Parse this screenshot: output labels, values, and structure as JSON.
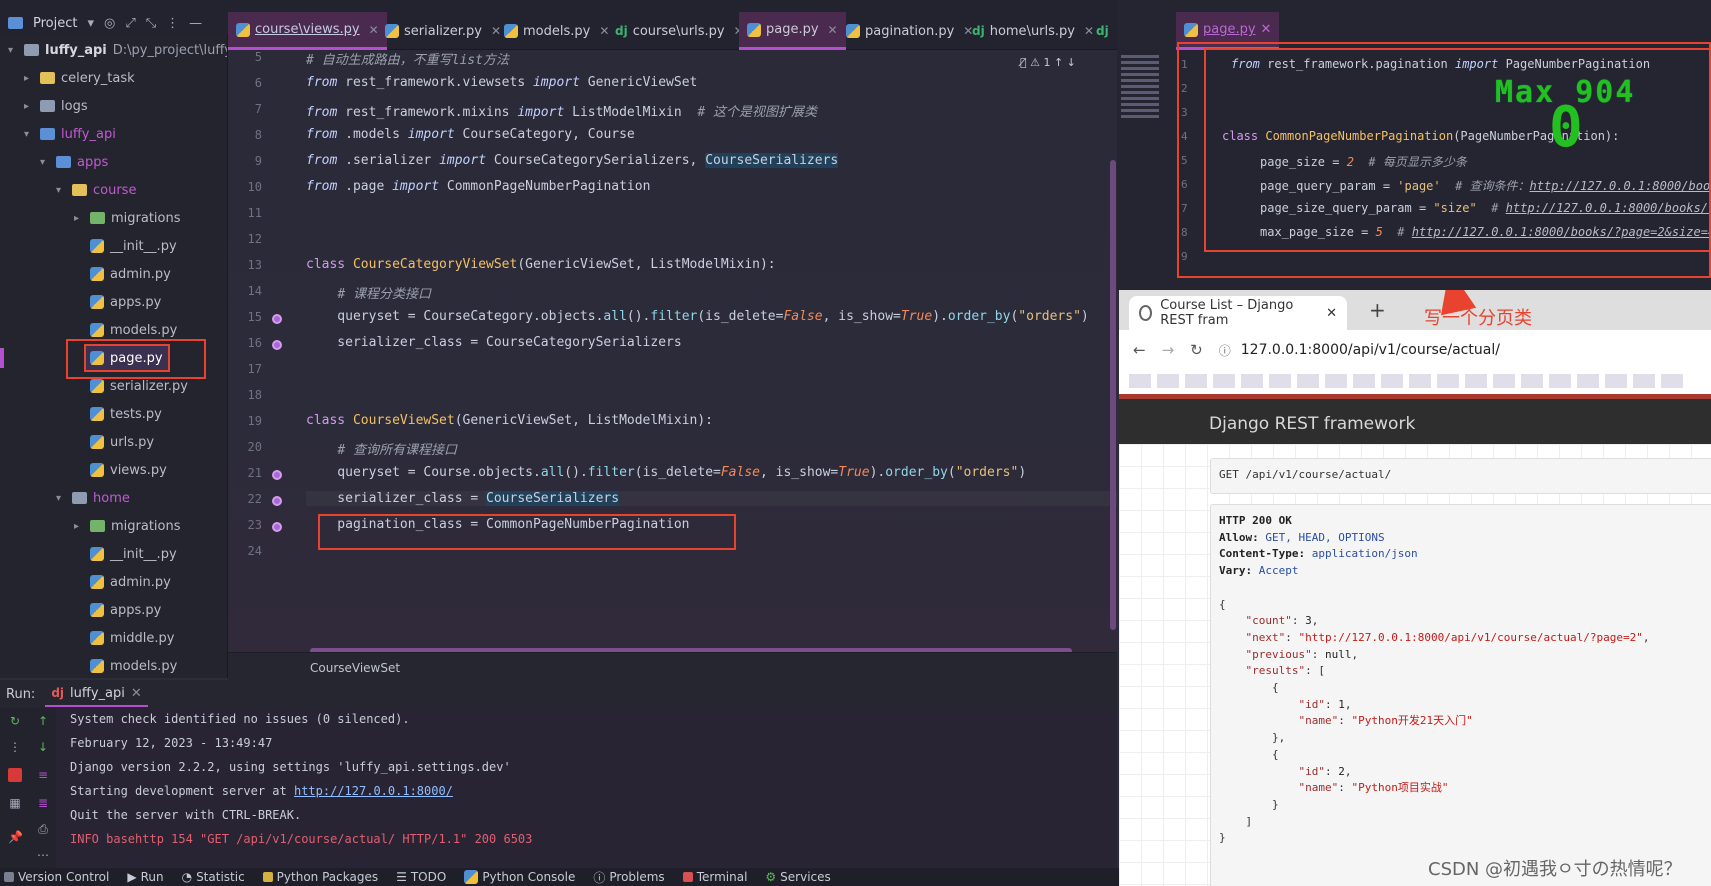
{
  "project_header": {
    "label": "Project"
  },
  "editor_tabs": [
    {
      "name": "course\\views.py",
      "type": "py"
    },
    {
      "name": "serializer.py",
      "type": "py"
    },
    {
      "name": "models.py",
      "type": "py"
    },
    {
      "name": "course\\urls.py",
      "type": "dj"
    },
    {
      "name": "page.py",
      "type": "py"
    },
    {
      "name": "pagination.py",
      "type": "py"
    },
    {
      "name": "home\\urls.py",
      "type": "dj"
    }
  ],
  "tree": {
    "root": {
      "name": "luffy_api",
      "path": "D:\\py_project\\luffy_api"
    },
    "items": [
      {
        "label": "celery_task"
      },
      {
        "label": "logs"
      },
      {
        "label": "luffy_api"
      },
      {
        "label": "apps"
      },
      {
        "label": "course"
      },
      {
        "label": "migrations"
      },
      {
        "label": "__init__.py"
      },
      {
        "label": "admin.py"
      },
      {
        "label": "apps.py"
      },
      {
        "label": "models.py"
      },
      {
        "label": "page.py"
      },
      {
        "label": "serializer.py"
      },
      {
        "label": "tests.py"
      },
      {
        "label": "urls.py"
      },
      {
        "label": "views.py"
      },
      {
        "label": "home"
      },
      {
        "label": "migrations"
      },
      {
        "label": "__init__.py"
      },
      {
        "label": "admin.py"
      },
      {
        "label": "apps.py"
      },
      {
        "label": "middle.py"
      },
      {
        "label": "models.py"
      }
    ]
  },
  "editor": {
    "line_numbers": [
      "5",
      "6",
      "7",
      "8",
      "9",
      "10",
      "11",
      "12",
      "13",
      "14",
      "15",
      "16",
      "17",
      "18",
      "19",
      "20",
      "21",
      "22",
      "23",
      "24"
    ],
    "inspection_count": "1",
    "breadcrumb": "CourseViewSet"
  },
  "right_pane": {
    "tab_name": "page.py",
    "line_numbers": [
      "1",
      "2",
      "3",
      "4",
      "5",
      "6",
      "7",
      "8",
      "9"
    ],
    "overlay_text": "Max 904",
    "overlay_digit": "0"
  },
  "browser": {
    "tab_title": "Course List – Django REST fram",
    "annotation": "写一个分页类",
    "url": "127.0.0.1:8000/api/v1/course/actual/",
    "brand": "Django REST framework",
    "request": "GET /api/v1/course/actual/",
    "watermark": "CSDN @初遇我ㅇ寸の热情呢？"
  },
  "run": {
    "label": "Run:",
    "tab": "luffy_api",
    "lines": [
      "System check identified no issues (0 silenced).",
      "February 12, 2023 - 13:49:47",
      "Django version 2.2.2, using settings 'luffy_api.settings.dev'",
      "Starting development server at ",
      "http://127.0.0.1:8000/",
      "Quit the server with CTRL-BREAK.",
      "INFO basehttp 154 \"GET /api/v1/course/actual/ HTTP/1.1\" 200 6503"
    ]
  },
  "status_bar": [
    {
      "label": "Version Control"
    },
    {
      "label": "Run"
    },
    {
      "label": "Statistic"
    },
    {
      "label": "Python Packages"
    },
    {
      "label": "TODO"
    },
    {
      "label": "Python Console"
    },
    {
      "label": "Problems"
    },
    {
      "label": "Terminal"
    },
    {
      "label": "Services"
    }
  ],
  "colors": {
    "accent": "#b44fd0",
    "annotation_red": "#e8432e",
    "overlay_green": "#23c11f"
  }
}
